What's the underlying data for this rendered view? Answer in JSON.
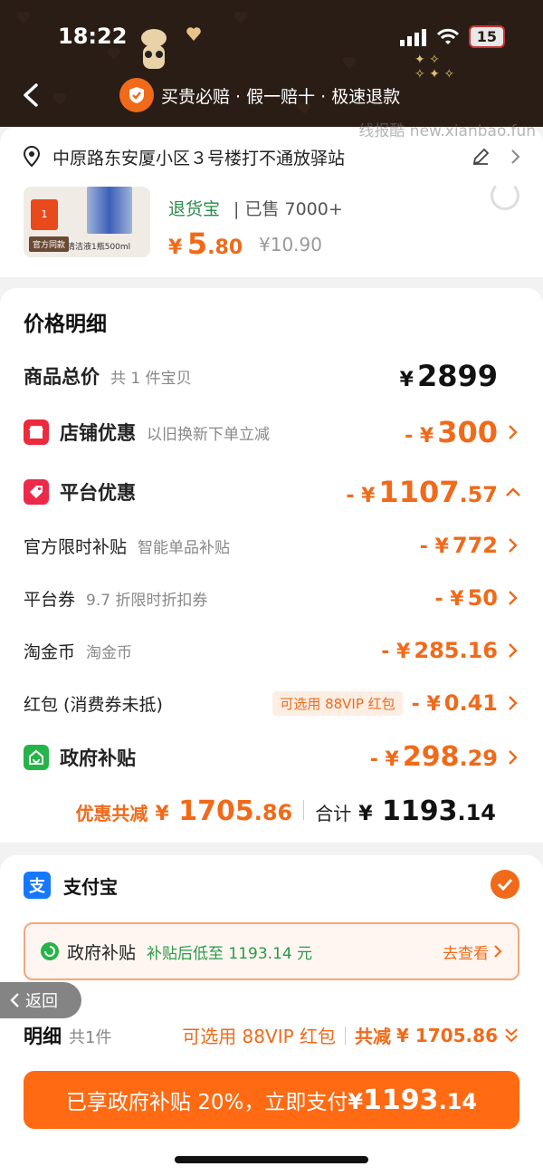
{
  "status_bar": {
    "time": "18:22",
    "battery": "15"
  },
  "header": {
    "guarantee_text": "买贵必赔 · 假一赔十 · 极速退款"
  },
  "watermark": "线报酷 new.xianbao.fun",
  "address": {
    "text": "中原路东安厦小区３号楼打不通放驿站"
  },
  "product": {
    "return_label": "退货宝",
    "sold_label": "已售 7000+",
    "price_symbol": "¥",
    "price_int": "5",
    "price_dec": ".80",
    "original_price": "¥10.90",
    "thumb_tag": "官方同款",
    "thumb_caption": "清洁液1瓶500ml",
    "thumb_rank": "1"
  },
  "price_detail": {
    "title": "价格明细",
    "total": {
      "label": "商品总价",
      "sub": "共 1 件宝贝",
      "symbol": "¥",
      "amount": "2899"
    },
    "store_discount": {
      "label": "店铺优惠",
      "sub": "以旧换新下单立减",
      "prefix": "- ¥",
      "amount": "300"
    },
    "platform_discount": {
      "label": "平台优惠",
      "prefix": "- ¥",
      "amount_int": "1107",
      "amount_dec": ".57"
    },
    "official_subsidy": {
      "label": "官方限时补贴",
      "sub": "智能单品补贴",
      "prefix": "- ¥",
      "amount": "772"
    },
    "platform_coupon": {
      "label": "平台券",
      "sub": "9.7 折限时折扣券",
      "prefix": "- ¥",
      "amount": "50"
    },
    "taojinbi": {
      "label": "淘金币",
      "sub": "淘金币",
      "prefix": "- ¥",
      "amount": "285.16"
    },
    "red_packet": {
      "label": "红包 (消费券未抵)",
      "tag": "可选用 88VIP 红包",
      "prefix": "- ¥",
      "amount": "0.41"
    },
    "gov_subsidy": {
      "label": "政府补贴",
      "prefix": "- ¥",
      "amount_int": "298",
      "amount_dec": ".29"
    },
    "summary": {
      "discount_label": "优惠共减",
      "discount_symbol": "¥",
      "discount_int": "1705",
      "discount_dec": ".86",
      "total_label": "合计",
      "total_symbol": "¥",
      "total_int": "1193",
      "total_dec": ".14"
    }
  },
  "payment": {
    "method_icon_char": "支",
    "method_label": "支付宝",
    "gov_banner": {
      "label": "政府补贴",
      "sub": "补贴后低至 1193.14 元",
      "link": "去查看"
    }
  },
  "back_float": "返回",
  "bottom_bar": {
    "detail_label": "明细",
    "detail_count": "共1件",
    "vip_link": "可选用 88VIP 红包",
    "discount_label": "共减",
    "discount_amount": "¥ 1705.86",
    "pay_button_text": "已享政府补贴 20%，立即支付",
    "pay_button_symbol": "¥",
    "pay_button_int": "1193",
    "pay_button_dec": ".14"
  },
  "colors": {
    "accent": "#f06a1a",
    "header_bg": "#2a1d16",
    "green": "#2a9a4a",
    "alipay_blue": "#1677ff"
  }
}
